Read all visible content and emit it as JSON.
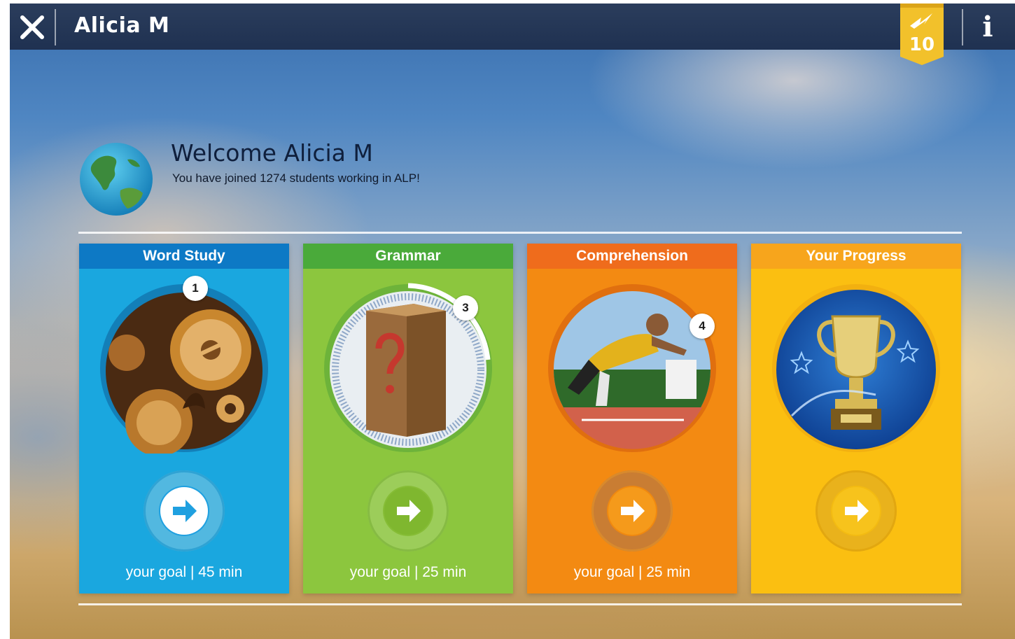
{
  "header": {
    "user_name": "Alicia M",
    "score": "10",
    "colors": {
      "bar": "#1f3151",
      "badge": "#f2c12b"
    },
    "icons": {
      "close": "close-icon",
      "score": "lightning-icon",
      "info": "info-icon"
    },
    "info_label": "i"
  },
  "welcome": {
    "title": "Welcome Alicia M",
    "subtitle": "You have joined 1274 students working in ALP!",
    "icon": "globe-icon"
  },
  "cards": [
    {
      "title": "Word Study",
      "goal": "your goal | 45 min",
      "step": "1",
      "color": "#1aa7df",
      "header_color": "#0d79c5",
      "art": "gears-image",
      "go_icon": "arrow-right-icon"
    },
    {
      "title": "Grammar",
      "goal": "your goal | 25 min",
      "step": "3",
      "color": "#8cc63e",
      "header_color": "#4aaa3a",
      "art": "mystery-crate-image",
      "go_icon": "arrow-right-icon"
    },
    {
      "title": "Comprehension",
      "goal": "your goal | 25 min",
      "step": "4",
      "color": "#f38a12",
      "header_color": "#ef6c1c",
      "art": "sprinter-image",
      "go_icon": "arrow-right-icon"
    },
    {
      "title": "Your Progress",
      "goal": "",
      "step": "",
      "color": "#fbbf11",
      "header_color": "#f7a51c",
      "art": "trophy-image",
      "go_icon": "arrow-right-icon"
    }
  ]
}
